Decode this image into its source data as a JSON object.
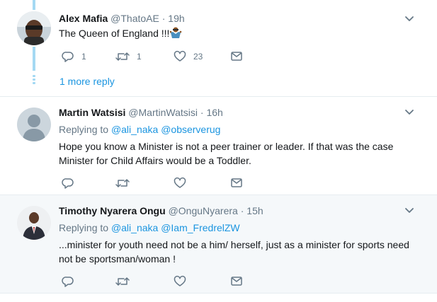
{
  "tweets": [
    {
      "name": "Alex Mafia",
      "handle": "@ThatoAE",
      "sep": "·",
      "time": "19h",
      "text": "The Queen of England !!!",
      "emoji": "person-shrugging",
      "counts": {
        "reply": "1",
        "retweet": "1",
        "like": "23"
      },
      "more_replies": "1 more reply"
    },
    {
      "name": "Martin Watsisi",
      "handle": "@MartinWatsisi",
      "sep": "·",
      "time": "16h",
      "replying_prefix": "Replying to",
      "replying_to": [
        "@ali_naka",
        "@observerug"
      ],
      "text_lines": [
        "Hope you know a Minister is not a peer trainer or leader.  If that was the case",
        "Minister for Child Affairs would be a Toddler."
      ]
    },
    {
      "name": "Timothy Nyarera Ongu",
      "handle": "@OnguNyarera",
      "sep": "·",
      "time": "15h",
      "replying_prefix": "Replying to",
      "replying_to": [
        "@ali_naka",
        "@Iam_FredrelZW"
      ],
      "text_lines": [
        "...minister for youth need not be a him/ herself, just as a minister for sports need",
        "not be sportsman/woman !"
      ]
    }
  ],
  "colors": {
    "accent": "#1b95e0",
    "muted": "#657786",
    "thread": "#a4d9f3",
    "highlight_bg": "#f5f8fa"
  }
}
